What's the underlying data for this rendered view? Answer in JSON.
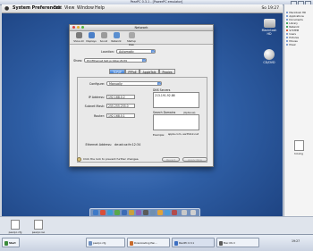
{
  "host": {
    "window_title": "PearPC 0.3.1 - [PowerPC emulator]",
    "taskbar_items": [
      {
        "label": "Start"
      },
      {
        "label": "pearpc.cfg"
      },
      {
        "label": "Downloading Pan..."
      },
      {
        "label": "PearPC 0.3.1"
      },
      {
        "label": "Mac OS X"
      }
    ],
    "tray_time": "19:27",
    "right_panel_items": [
      "Macintosh HD",
      "Applications",
      "Documents",
      "Library",
      "Network",
      "SYSTEM",
      "Users",
      "Pictures",
      "Movies",
      "Music"
    ],
    "desktop_files": [
      {
        "label": "pearpc.cfg"
      },
      {
        "label": "pearpc.iso"
      },
      {
        "label": "hd.img"
      }
    ]
  },
  "mac_menubar": {
    "apple": "",
    "items": [
      "System Preferences",
      "Edit",
      "View",
      "Window",
      "Help"
    ],
    "clock": "So 19:27"
  },
  "desktop_icons": [
    {
      "label": "Macintosh HD"
    },
    {
      "label": "CD/DVD"
    }
  ],
  "prefs_window": {
    "title": "Network",
    "toolbar": [
      {
        "label": "Show All",
        "icon": "show-all-icon",
        "color": "#7a7a7a"
      },
      {
        "label": "Displays",
        "icon": "displays-icon",
        "color": "#4a7fc8"
      },
      {
        "label": "Sound",
        "icon": "sound-icon",
        "color": "#9a9a9a"
      },
      {
        "label": "Network",
        "icon": "network-icon",
        "color": "#5a8fd0"
      },
      {
        "label": "Startup Disk",
        "icon": "startup-disk-icon",
        "color": "#a8a8a8"
      }
    ],
    "location": {
      "label": "Location:",
      "value": "Automatic"
    },
    "show": {
      "label": "Show:",
      "value": "PCI Ethernet Slot pci10ec,8139"
    },
    "tabs": [
      "TCP/IP",
      "PPPoE",
      "AppleTalk",
      "Proxies"
    ],
    "configure": {
      "label": "Configure:",
      "value": "Manually"
    },
    "ip_address": {
      "label": "IP Address:",
      "value": "192.168.0.2"
    },
    "subnet_mask": {
      "label": "Subnet Mask:",
      "value": "255.255.255.0"
    },
    "router": {
      "label": "Router:",
      "value": "192.168.0.1"
    },
    "dns": {
      "label": "DNS Servers",
      "value": "213.191.92.86"
    },
    "search_domains": {
      "label": "Search Domains",
      "optional": "(Optional)"
    },
    "example": {
      "label": "Example:",
      "value": "apple.com, earthlink.net"
    },
    "ethernet": {
      "label": "Ethernet Address:",
      "value": "de:ad:ca:fe:12:34"
    },
    "lock_text": "Click the lock to prevent further changes.",
    "revert_label": "Revert",
    "apply_label": "Apply Now"
  },
  "colors": {
    "accent": "#3f7fd6",
    "desktop": "#2f5fa6"
  }
}
